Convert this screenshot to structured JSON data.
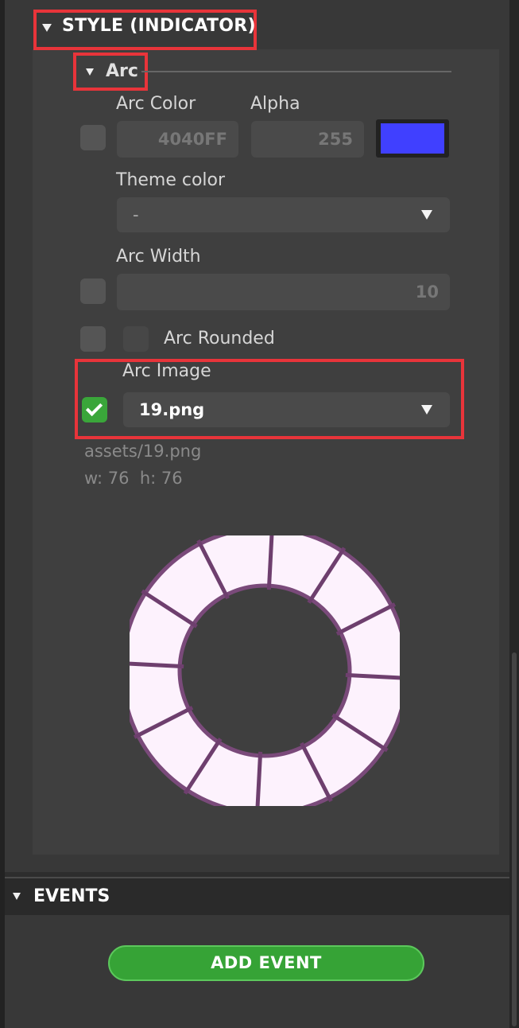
{
  "style_section": {
    "title": "STYLE (INDICATOR)"
  },
  "arc_group": {
    "title": "Arc"
  },
  "arc_color": {
    "label": "Arc Color",
    "value": "4040FF",
    "swatch": "#4040FF"
  },
  "alpha": {
    "label": "Alpha",
    "value": "255"
  },
  "theme_color": {
    "label": "Theme color",
    "value": "-"
  },
  "arc_width": {
    "label": "Arc Width",
    "value": "10"
  },
  "arc_rounded": {
    "label": "Arc Rounded",
    "checked": false
  },
  "arc_image": {
    "label": "Arc Image",
    "value": "19.png",
    "enabled": true,
    "path": "assets/19.png",
    "size_text": "w: 76  h: 76"
  },
  "events_section": {
    "title": "EVENTS"
  },
  "add_event": {
    "label": "ADD EVENT"
  },
  "colors": {
    "highlight": "#e8343a",
    "accent_green": "#36a336",
    "panel": "#3f3f3f"
  },
  "icons": [
    "triangle-down-icon",
    "check-icon",
    "dropdown-arrow-icon"
  ]
}
